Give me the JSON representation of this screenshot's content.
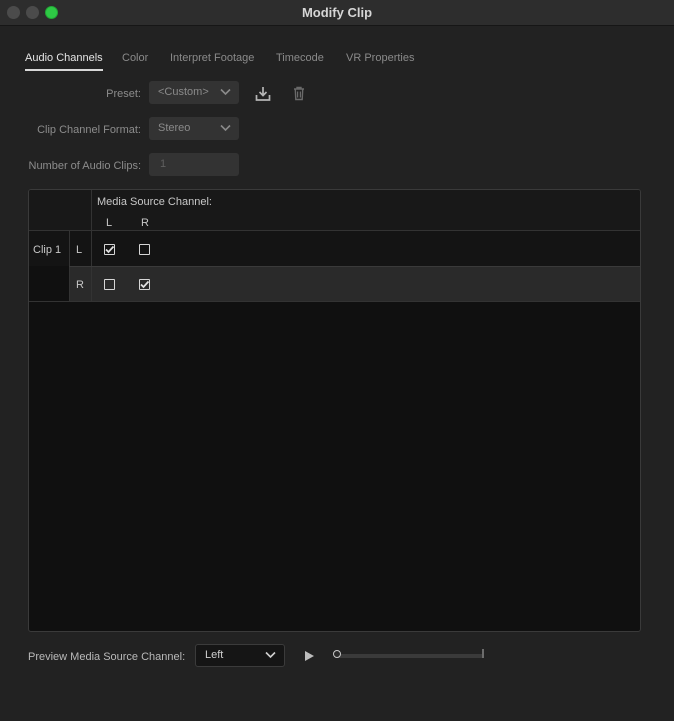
{
  "window": {
    "title": "Modify Clip"
  },
  "tabs": [
    {
      "label": "Audio Channels",
      "active": true
    },
    {
      "label": "Color",
      "active": false
    },
    {
      "label": "Interpret Footage",
      "active": false
    },
    {
      "label": "Timecode",
      "active": false
    },
    {
      "label": "VR Properties",
      "active": false
    }
  ],
  "form": {
    "preset_label": "Preset:",
    "preset_value": "<Custom>",
    "format_label": "Clip Channel Format:",
    "format_value": "Stereo",
    "num_clips_label": "Number of Audio Clips:",
    "num_clips_value": "1"
  },
  "icons": {
    "save_preset": "download-icon",
    "delete_preset": "trash-icon"
  },
  "grid": {
    "header_title": "Media Source Channel:",
    "columns": [
      "L",
      "R"
    ],
    "clip_label": "Clip 1",
    "rows": [
      {
        "channel": "L",
        "checks": [
          true,
          false
        ]
      },
      {
        "channel": "R",
        "checks": [
          false,
          true
        ]
      }
    ]
  },
  "preview": {
    "label": "Preview Media Source Channel:",
    "channel_value": "Left",
    "position": 0
  },
  "colors": {
    "background": "#222222",
    "close_button": "#4b4b4b",
    "zoom_button": "#2ec945",
    "selected_row": "#2a2a2a"
  }
}
